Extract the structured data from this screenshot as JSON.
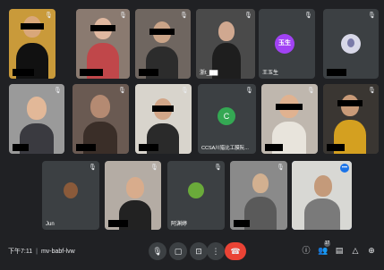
{
  "colors": {
    "background": "#202124",
    "tile": "#3c4043",
    "active_outline": "#8ab4f8",
    "end_call": "#ea4335",
    "avatar_purple": "#a142f4",
    "avatar_green": "#34a853"
  },
  "participants": {
    "p1": {
      "name": ""
    },
    "p2": {
      "name": ""
    },
    "p3": {
      "name": ""
    },
    "p4": {
      "name": "浙t_▇▇"
    },
    "p5": {
      "name": "王玉生",
      "avatar_text": "玉生"
    },
    "p6": {
      "name": ""
    },
    "p7": {
      "name": ""
    },
    "p8": {
      "name": ""
    },
    "p9": {
      "name": ""
    },
    "p10": {
      "name": "CCSA川猎比工膜阮...",
      "avatar_text": "C"
    },
    "p11": {
      "name": ""
    },
    "p12": {
      "name": ""
    },
    "p13": {
      "name": "Jun"
    },
    "p14": {
      "name": ""
    },
    "p15": {
      "name": "阿渊婷"
    },
    "p16": {
      "name": ""
    },
    "p17": {
      "name": ""
    }
  },
  "meeting": {
    "time": "下午7:11",
    "separator": "|",
    "code": "mv-babf-lvw"
  },
  "controls": {
    "mic_icon": "🎙",
    "camera_icon": "▢",
    "present_icon": "⊡",
    "more_icon": "⋮",
    "end_icon": "☎"
  },
  "right_controls": {
    "info_icon": "ⓘ",
    "people_icon": "👥",
    "people_count": "17",
    "chat_icon": "▤",
    "activities_icon": "△",
    "host_icon": "⊕"
  },
  "tile_more_icon": "•••"
}
